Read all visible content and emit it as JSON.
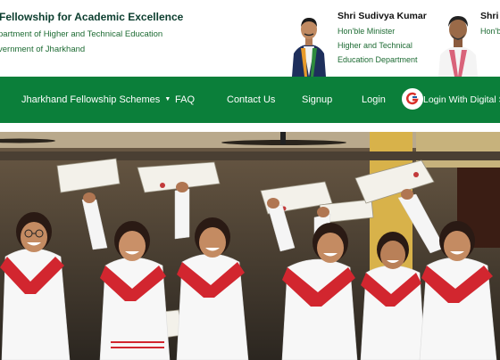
{
  "header": {
    "site_title": "Fellowship for Academic Excellence",
    "dept_line1": "partment of Higher and Technical Education",
    "dept_line2": "vernment of Jharkhand",
    "dignitaries": [
      {
        "name": "Shri Sudivya Kumar",
        "role1": "Hon'ble Minister",
        "role2": "Higher and Technical",
        "role3": "Education Department"
      },
      {
        "name": "Shri H",
        "role1": "Hon'b"
      }
    ]
  },
  "nav": {
    "items": [
      {
        "label": "Jharkhand Fellowship Schemes"
      },
      {
        "label": "FAQ"
      },
      {
        "label": "Contact Us"
      },
      {
        "label": "Signup"
      },
      {
        "label": "Login"
      }
    ],
    "digilocker_label": "Login With Digital Sev"
  },
  "colors": {
    "nav_green": "#0b7f3a",
    "text_green": "#1d6b33",
    "uniform_red": "#d2262f"
  },
  "icons": {
    "dropdown": "caret-down-icon",
    "digilocker": "digilocker-logo-icon"
  }
}
